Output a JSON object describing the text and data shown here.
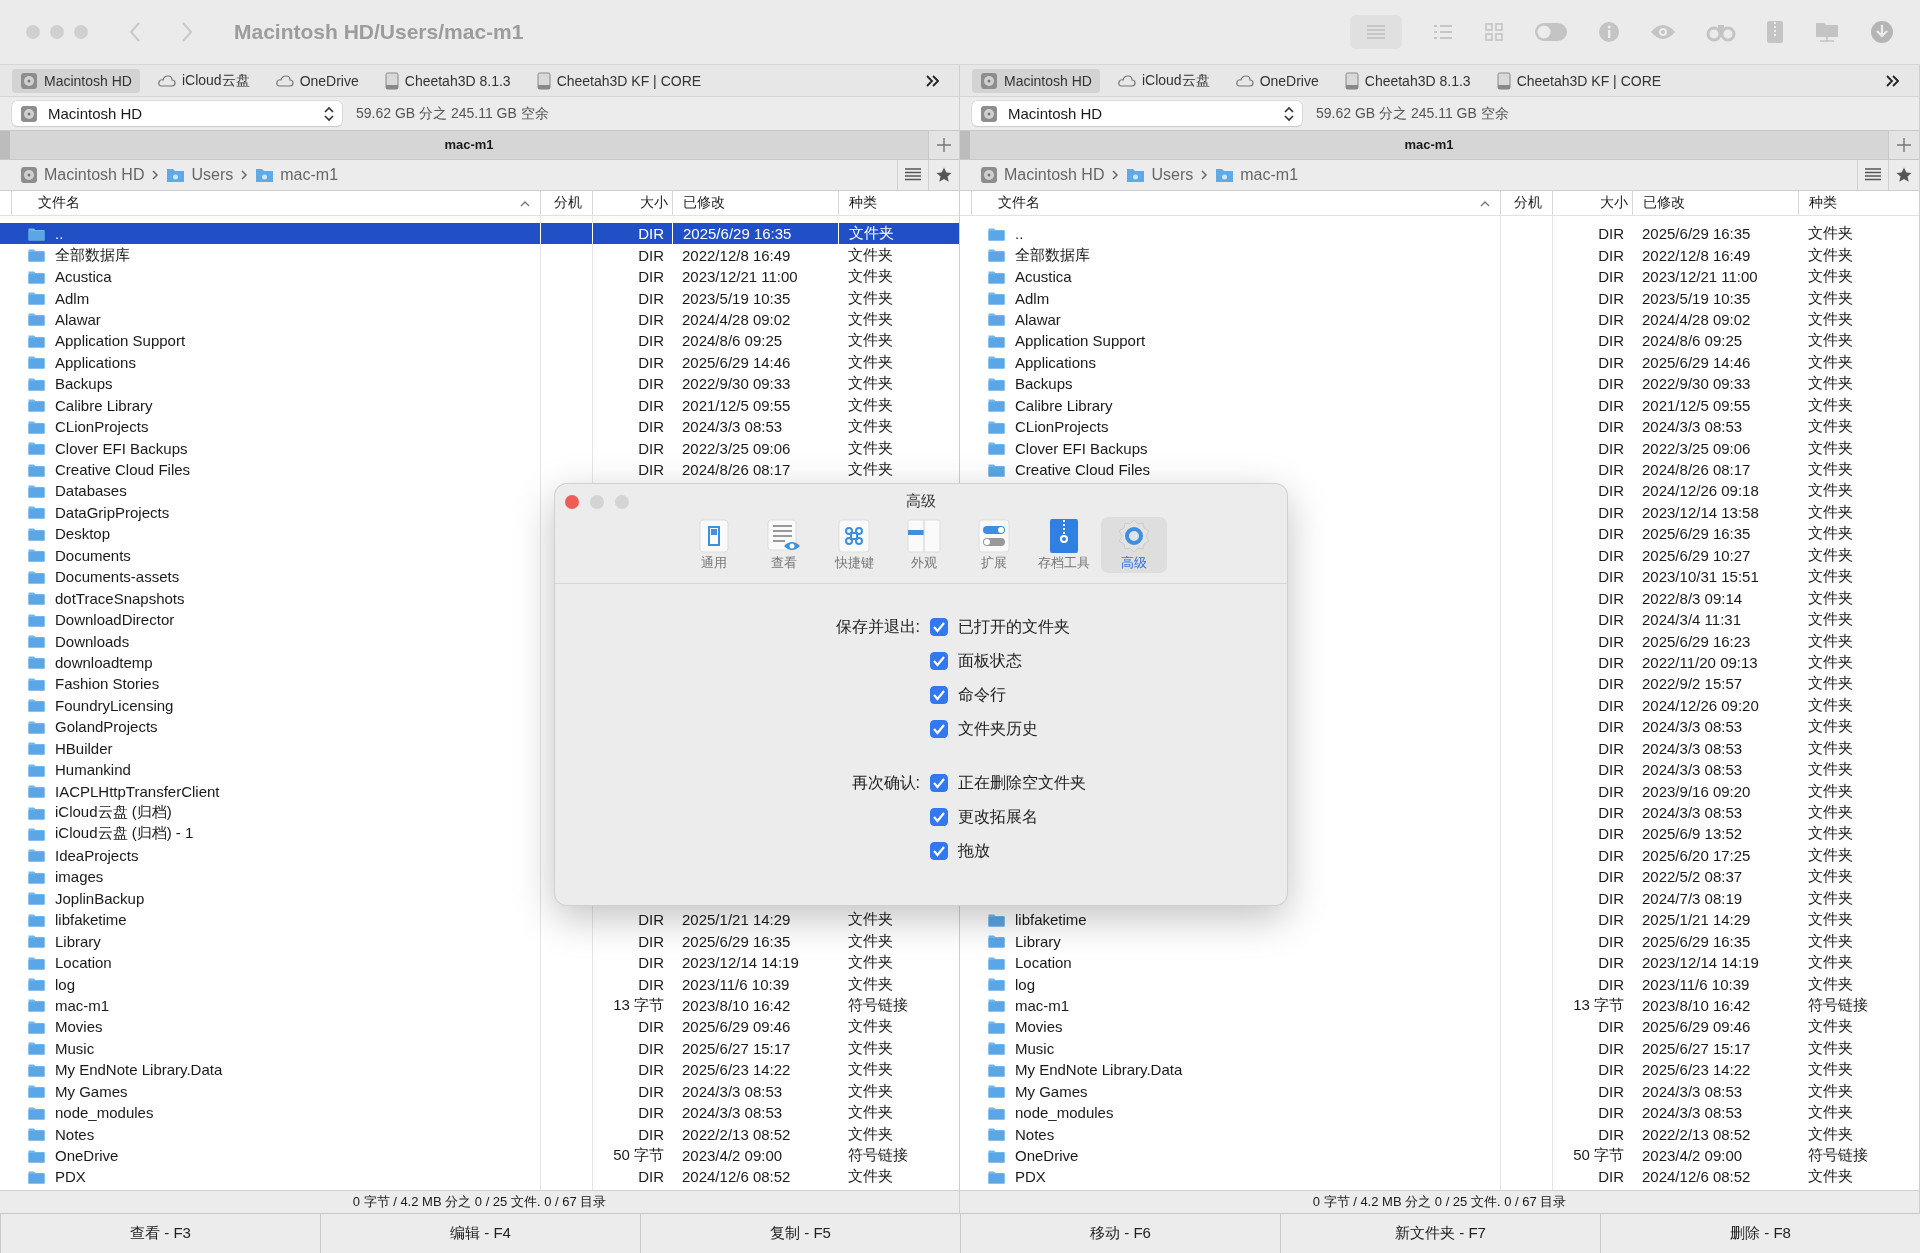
{
  "window": {
    "title": "Macintosh HD/Users/mac-m1"
  },
  "panes": [
    {
      "bookmarks": [
        {
          "label": "Macintosh HD",
          "kind": "disk",
          "selected": true
        },
        {
          "label": "iCloud云盘",
          "kind": "cloud",
          "selected": false
        },
        {
          "label": "OneDrive",
          "kind": "cloud",
          "selected": false
        },
        {
          "label": "Cheetah3D 8.1.3",
          "kind": "volume",
          "selected": false
        },
        {
          "label": "Cheetah3D KF | CORE",
          "kind": "volume",
          "selected": false
        }
      ],
      "drive": {
        "value": "Macintosh HD"
      },
      "free_space": "59.62 GB 分之 245.11 GB 空余",
      "tab_title": "mac-m1",
      "breadcrumb": [
        {
          "label": "Macintosh HD",
          "kind": "disk"
        },
        {
          "label": "Users",
          "kind": "folder"
        },
        {
          "label": "mac-m1",
          "kind": "home"
        }
      ],
      "columns": [
        "文件名",
        "分机",
        "大小",
        "已修改",
        "种类"
      ],
      "rows": [
        {
          "name": "..",
          "size": "DIR",
          "modified": "2025/6/29 16:35",
          "type": "文件夹",
          "selected": true
        },
        {
          "name": "全部数据库",
          "size": "DIR",
          "modified": "2022/12/8 16:49",
          "type": "文件夹",
          "selected": false
        },
        {
          "name": "Acustica",
          "size": "DIR",
          "modified": "2023/12/21 11:00",
          "type": "文件夹",
          "selected": false
        },
        {
          "name": "Adlm",
          "size": "DIR",
          "modified": "2023/5/19 10:35",
          "type": "文件夹",
          "selected": false
        },
        {
          "name": "Alawar",
          "size": "DIR",
          "modified": "2024/4/28 09:02",
          "type": "文件夹",
          "selected": false
        },
        {
          "name": "Application Support",
          "size": "DIR",
          "modified": "2024/8/6 09:25",
          "type": "文件夹",
          "selected": false
        },
        {
          "name": "Applications",
          "size": "DIR",
          "modified": "2025/6/29 14:46",
          "type": "文件夹",
          "selected": false
        },
        {
          "name": "Backups",
          "size": "DIR",
          "modified": "2022/9/30 09:33",
          "type": "文件夹",
          "selected": false
        },
        {
          "name": "Calibre Library",
          "size": "DIR",
          "modified": "2021/12/5 09:55",
          "type": "文件夹",
          "selected": false
        },
        {
          "name": "CLionProjects",
          "size": "DIR",
          "modified": "2024/3/3 08:53",
          "type": "文件夹",
          "selected": false
        },
        {
          "name": "Clover EFI Backups",
          "size": "DIR",
          "modified": "2022/3/25 09:06",
          "type": "文件夹",
          "selected": false
        },
        {
          "name": "Creative Cloud Files",
          "size": "DIR",
          "modified": "2024/8/26 08:17",
          "type": "文件夹",
          "selected": false
        },
        {
          "name": "Databases",
          "selected": false
        },
        {
          "name": "DataGripProjects",
          "selected": false
        },
        {
          "name": "Desktop",
          "selected": false
        },
        {
          "name": "Documents",
          "selected": false
        },
        {
          "name": "Documents-assets",
          "selected": false
        },
        {
          "name": "dotTraceSnapshots",
          "selected": false
        },
        {
          "name": "DownloadDirector",
          "selected": false
        },
        {
          "name": "Downloads",
          "selected": false
        },
        {
          "name": "downloadtemp",
          "selected": false
        },
        {
          "name": "Fashion Stories",
          "selected": false
        },
        {
          "name": "FoundryLicensing",
          "selected": false
        },
        {
          "name": "GolandProjects",
          "selected": false
        },
        {
          "name": "HBuilder",
          "selected": false
        },
        {
          "name": "Humankind",
          "selected": false
        },
        {
          "name": "IACPLHttpTransferClient",
          "selected": false
        },
        {
          "name": "iCloud云盘 (归档)",
          "selected": false
        },
        {
          "name": "iCloud云盘 (归档) - 1",
          "selected": false
        },
        {
          "name": "IdeaProjects",
          "selected": false
        },
        {
          "name": "images",
          "selected": false
        },
        {
          "name": "JoplinBackup",
          "selected": false
        },
        {
          "name": "libfaketime",
          "size": "DIR",
          "modified": "2025/1/21 14:29",
          "type": "文件夹",
          "selected": false
        },
        {
          "name": "Library",
          "size": "DIR",
          "modified": "2025/6/29 16:35",
          "type": "文件夹",
          "selected": false
        },
        {
          "name": "Location",
          "size": "DIR",
          "modified": "2023/12/14 14:19",
          "type": "文件夹",
          "selected": false
        },
        {
          "name": "log",
          "size": "DIR",
          "modified": "2023/11/6 10:39",
          "type": "文件夹",
          "selected": false
        },
        {
          "name": "mac-m1",
          "size": "13 字节",
          "modified": "2023/8/10 16:42",
          "type": "符号链接",
          "selected": false
        },
        {
          "name": "Movies",
          "size": "DIR",
          "modified": "2025/6/29 09:46",
          "type": "文件夹",
          "selected": false
        },
        {
          "name": "Music",
          "size": "DIR",
          "modified": "2025/6/27 15:17",
          "type": "文件夹",
          "selected": false
        },
        {
          "name": "My EndNote Library.Data",
          "size": "DIR",
          "modified": "2025/6/23 14:22",
          "type": "文件夹",
          "selected": false
        },
        {
          "name": "My Games",
          "size": "DIR",
          "modified": "2024/3/3 08:53",
          "type": "文件夹",
          "selected": false
        },
        {
          "name": "node_modules",
          "size": "DIR",
          "modified": "2024/3/3 08:53",
          "type": "文件夹",
          "selected": false
        },
        {
          "name": "Notes",
          "size": "DIR",
          "modified": "2022/2/13 08:52",
          "type": "文件夹",
          "selected": false
        },
        {
          "name": "OneDrive",
          "size": "50 字节",
          "modified": "2023/4/2 09:00",
          "type": "符号链接",
          "selected": false
        },
        {
          "name": "PDX",
          "size": "DIR",
          "modified": "2024/12/6 08:52",
          "type": "文件夹",
          "selected": false
        }
      ],
      "status": "0 字节 / 4.2 MB 分之 0 / 25 文件. 0 / 67 目录"
    },
    {
      "bookmarks": [
        {
          "label": "Macintosh HD",
          "kind": "disk",
          "selected": true
        },
        {
          "label": "iCloud云盘",
          "kind": "cloud",
          "selected": false
        },
        {
          "label": "OneDrive",
          "kind": "cloud",
          "selected": false
        },
        {
          "label": "Cheetah3D 8.1.3",
          "kind": "volume",
          "selected": false
        },
        {
          "label": "Cheetah3D KF | CORE",
          "kind": "volume",
          "selected": false
        }
      ],
      "drive": {
        "value": "Macintosh HD"
      },
      "free_space": "59.62 GB 分之 245.11 GB 空余",
      "tab_title": "mac-m1",
      "breadcrumb": [
        {
          "label": "Macintosh HD",
          "kind": "disk"
        },
        {
          "label": "Users",
          "kind": "folder"
        },
        {
          "label": "mac-m1",
          "kind": "home"
        }
      ],
      "columns": [
        "文件名",
        "分机",
        "大小",
        "已修改",
        "种类"
      ],
      "rows": [
        {
          "name": "..",
          "size": "DIR",
          "modified": "2025/6/29 16:35",
          "type": "文件夹",
          "selected": false
        },
        {
          "name": "全部数据库",
          "size": "DIR",
          "modified": "2022/12/8 16:49",
          "type": "文件夹",
          "selected": false
        },
        {
          "name": "Acustica",
          "size": "DIR",
          "modified": "2023/12/21 11:00",
          "type": "文件夹",
          "selected": false
        },
        {
          "name": "Adlm",
          "size": "DIR",
          "modified": "2023/5/19 10:35",
          "type": "文件夹",
          "selected": false
        },
        {
          "name": "Alawar",
          "size": "DIR",
          "modified": "2024/4/28 09:02",
          "type": "文件夹",
          "selected": false
        },
        {
          "name": "Application Support",
          "size": "DIR",
          "modified": "2024/8/6 09:25",
          "type": "文件夹",
          "selected": false
        },
        {
          "name": "Applications",
          "size": "DIR",
          "modified": "2025/6/29 14:46",
          "type": "文件夹",
          "selected": false
        },
        {
          "name": "Backups",
          "size": "DIR",
          "modified": "2022/9/30 09:33",
          "type": "文件夹",
          "selected": false
        },
        {
          "name": "Calibre Library",
          "size": "DIR",
          "modified": "2021/12/5 09:55",
          "type": "文件夹",
          "selected": false
        },
        {
          "name": "CLionProjects",
          "size": "DIR",
          "modified": "2024/3/3 08:53",
          "type": "文件夹",
          "selected": false
        },
        {
          "name": "Clover EFI Backups",
          "size": "DIR",
          "modified": "2022/3/25 09:06",
          "type": "文件夹",
          "selected": false
        },
        {
          "name": "Creative Cloud Files",
          "size": "DIR",
          "modified": "2024/8/26 08:17",
          "type": "文件夹",
          "selected": false
        },
        {
          "size": "DIR",
          "modified": "2024/12/26 09:18",
          "type": "文件夹",
          "selected": false
        },
        {
          "size": "DIR",
          "modified": "2023/12/14 13:58",
          "type": "文件夹",
          "selected": false
        },
        {
          "size": "DIR",
          "modified": "2025/6/29 16:35",
          "type": "文件夹",
          "selected": false
        },
        {
          "size": "DIR",
          "modified": "2025/6/29 10:27",
          "type": "文件夹",
          "selected": false
        },
        {
          "size": "DIR",
          "modified": "2023/10/31 15:51",
          "type": "文件夹",
          "selected": false
        },
        {
          "size": "DIR",
          "modified": "2022/8/3 09:14",
          "type": "文件夹",
          "selected": false
        },
        {
          "size": "DIR",
          "modified": "2024/3/4 11:31",
          "type": "文件夹",
          "selected": false
        },
        {
          "size": "DIR",
          "modified": "2025/6/29 16:23",
          "type": "文件夹",
          "selected": false
        },
        {
          "size": "DIR",
          "modified": "2022/11/20 09:13",
          "type": "文件夹",
          "selected": false
        },
        {
          "size": "DIR",
          "modified": "2022/9/2 15:57",
          "type": "文件夹",
          "selected": false
        },
        {
          "size": "DIR",
          "modified": "2024/12/26 09:20",
          "type": "文件夹",
          "selected": false
        },
        {
          "size": "DIR",
          "modified": "2024/3/3 08:53",
          "type": "文件夹",
          "selected": false
        },
        {
          "size": "DIR",
          "modified": "2024/3/3 08:53",
          "type": "文件夹",
          "selected": false
        },
        {
          "size": "DIR",
          "modified": "2024/3/3 08:53",
          "type": "文件夹",
          "selected": false
        },
        {
          "size": "DIR",
          "modified": "2023/9/16 09:20",
          "type": "文件夹",
          "selected": false
        },
        {
          "size": "DIR",
          "modified": "2024/3/3 08:53",
          "type": "文件夹",
          "selected": false
        },
        {
          "size": "DIR",
          "modified": "2025/6/9 13:52",
          "type": "文件夹",
          "selected": false
        },
        {
          "size": "DIR",
          "modified": "2025/6/20 17:25",
          "type": "文件夹",
          "selected": false
        },
        {
          "size": "DIR",
          "modified": "2022/5/2 08:37",
          "type": "文件夹",
          "selected": false
        },
        {
          "size": "DIR",
          "modified": "2024/7/3 08:19",
          "type": "文件夹",
          "selected": false
        },
        {
          "name": "libfaketime",
          "size": "DIR",
          "modified": "2025/1/21 14:29",
          "type": "文件夹",
          "selected": false
        },
        {
          "name": "Library",
          "size": "DIR",
          "modified": "2025/6/29 16:35",
          "type": "文件夹",
          "selected": false
        },
        {
          "name": "Location",
          "size": "DIR",
          "modified": "2023/12/14 14:19",
          "type": "文件夹",
          "selected": false
        },
        {
          "name": "log",
          "size": "DIR",
          "modified": "2023/11/6 10:39",
          "type": "文件夹",
          "selected": false
        },
        {
          "name": "mac-m1",
          "size": "13 字节",
          "modified": "2023/8/10 16:42",
          "type": "符号链接",
          "selected": false
        },
        {
          "name": "Movies",
          "size": "DIR",
          "modified": "2025/6/29 09:46",
          "type": "文件夹",
          "selected": false
        },
        {
          "name": "Music",
          "size": "DIR",
          "modified": "2025/6/27 15:17",
          "type": "文件夹",
          "selected": false
        },
        {
          "name": "My EndNote Library.Data",
          "size": "DIR",
          "modified": "2025/6/23 14:22",
          "type": "文件夹",
          "selected": false
        },
        {
          "name": "My Games",
          "size": "DIR",
          "modified": "2024/3/3 08:53",
          "type": "文件夹",
          "selected": false
        },
        {
          "name": "node_modules",
          "size": "DIR",
          "modified": "2024/3/3 08:53",
          "type": "文件夹",
          "selected": false
        },
        {
          "name": "Notes",
          "size": "DIR",
          "modified": "2022/2/13 08:52",
          "type": "文件夹",
          "selected": false
        },
        {
          "name": "OneDrive",
          "size": "50 字节",
          "modified": "2023/4/2 09:00",
          "type": "符号链接",
          "selected": false
        },
        {
          "name": "PDX",
          "size": "DIR",
          "modified": "2024/12/6 08:52",
          "type": "文件夹",
          "selected": false
        }
      ],
      "status": "0 字节 / 4.2 MB 分之 0 / 25 文件. 0 / 67 目录"
    }
  ],
  "function_keys": [
    "查看 - F3",
    "编辑 - F4",
    "复制 - F5",
    "移动 - F6",
    "新文件夹 - F7",
    "删除 - F8"
  ],
  "dialog": {
    "title": "高级",
    "tabs": [
      {
        "label": "通用",
        "selected": false
      },
      {
        "label": "查看",
        "selected": false
      },
      {
        "label": "快捷键",
        "selected": false
      },
      {
        "label": "外观",
        "selected": false
      },
      {
        "label": "扩展",
        "selected": false
      },
      {
        "label": "存档工具",
        "selected": false
      },
      {
        "label": "高级",
        "selected": true
      }
    ],
    "groups": [
      {
        "label": "保存并退出:",
        "options": [
          {
            "label": "已打开的文件夹",
            "checked": true
          },
          {
            "label": "面板状态",
            "checked": true
          },
          {
            "label": "命令行",
            "checked": true
          },
          {
            "label": "文件夹历史",
            "checked": true
          }
        ]
      },
      {
        "label": "再次确认:",
        "options": [
          {
            "label": "正在删除空文件夹",
            "checked": true
          },
          {
            "label": "更改拓展名",
            "checked": true
          },
          {
            "label": "拖放",
            "checked": true
          }
        ]
      }
    ]
  }
}
